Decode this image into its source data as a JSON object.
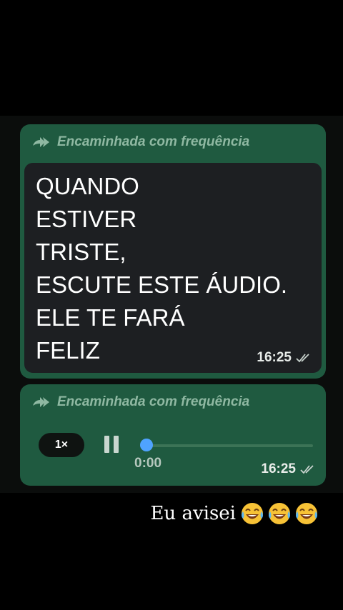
{
  "forwarded_label": "Encaminhada com frequência",
  "text_message": {
    "lines": [
      "QUANDO",
      "ESTIVER",
      "TRISTE,",
      "ESCUTE ESTE ÁUDIO.",
      "ELE TE FARÁ",
      "FELIZ"
    ],
    "time": "16:25",
    "status_icon": "double-check-icon"
  },
  "audio_message": {
    "speed": "1×",
    "duration": "0:00",
    "progress": 0,
    "time": "16:25",
    "status_icon": "double-check-icon",
    "control_icon": "pause-icon"
  },
  "caption": {
    "text": "Eu avisei",
    "emoji": [
      "face-with-tears-of-joy",
      "face-with-tears-of-joy",
      "face-with-tears-of-joy"
    ]
  },
  "colors": {
    "bubble": "#1f5a40",
    "inner_bubble": "#1d1f22",
    "accent": "#4fa3ff",
    "forwarded_text": "#8fb8a2"
  }
}
